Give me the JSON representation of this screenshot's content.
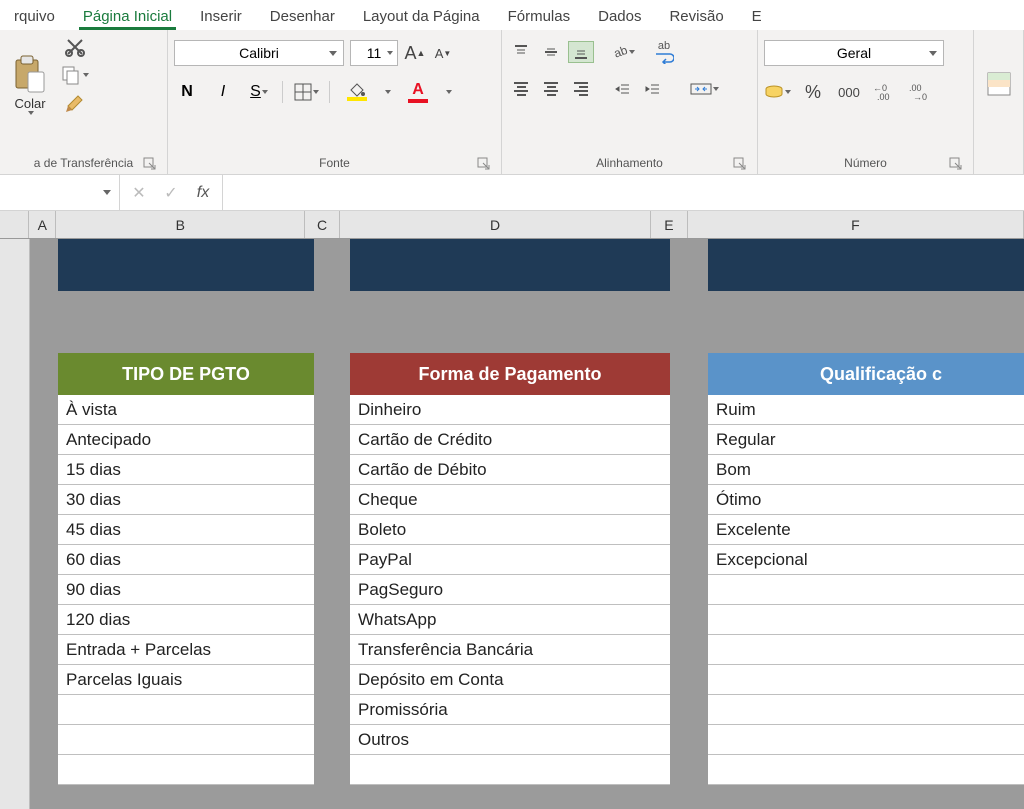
{
  "tabs": {
    "arquivo": "rquivo",
    "home": "Página Inicial",
    "inserir": "Inserir",
    "desenhar": "Desenhar",
    "layout": "Layout da Página",
    "formulas": "Fórmulas",
    "dados": "Dados",
    "revisao": "Revisão",
    "extra": "E"
  },
  "ribbon": {
    "clipboard": {
      "colar": "Colar",
      "label": "a de Transferência"
    },
    "font": {
      "name": "Calibri",
      "size": "11",
      "bold": "N",
      "italic": "I",
      "underline": "S",
      "label": "Fonte"
    },
    "align": {
      "label": "Alinhamento",
      "wrap": "ab"
    },
    "number": {
      "format": "Geral",
      "percent": "%",
      "comma": "000",
      "inc": "00",
      "dec": "00",
      "label": "Número"
    }
  },
  "formula_bar": {
    "fx": "fx",
    "value": ""
  },
  "columns": {
    "A": "A",
    "B": "B",
    "C": "C",
    "D": "D",
    "E": "E",
    "F": "F"
  },
  "col_widths": {
    "A": 28,
    "B": 256,
    "C": 36,
    "D": 320,
    "E": 38,
    "F": 346
  },
  "sheet": {
    "header_tipo": "TIPO DE PGTO",
    "header_forma": "Forma de Pagamento",
    "header_qual": "Qualificação c",
    "tipo": [
      "À vista",
      "Antecipado",
      "15 dias",
      "30 dias",
      "45 dias",
      "60 dias",
      "90 dias",
      "120 dias",
      "Entrada + Parcelas",
      "Parcelas Iguais"
    ],
    "forma": [
      "Dinheiro",
      "Cartão de Crédito",
      "Cartão de Débito",
      "Cheque",
      "Boleto",
      "PayPal",
      "PagSeguro",
      "WhatsApp",
      "Transferência Bancária",
      "Depósito em Conta",
      "Promissória",
      "Outros"
    ],
    "qual": [
      "Ruim",
      "Regular",
      "Bom",
      "Ótimo",
      "Excelente",
      "Excepcional"
    ]
  }
}
